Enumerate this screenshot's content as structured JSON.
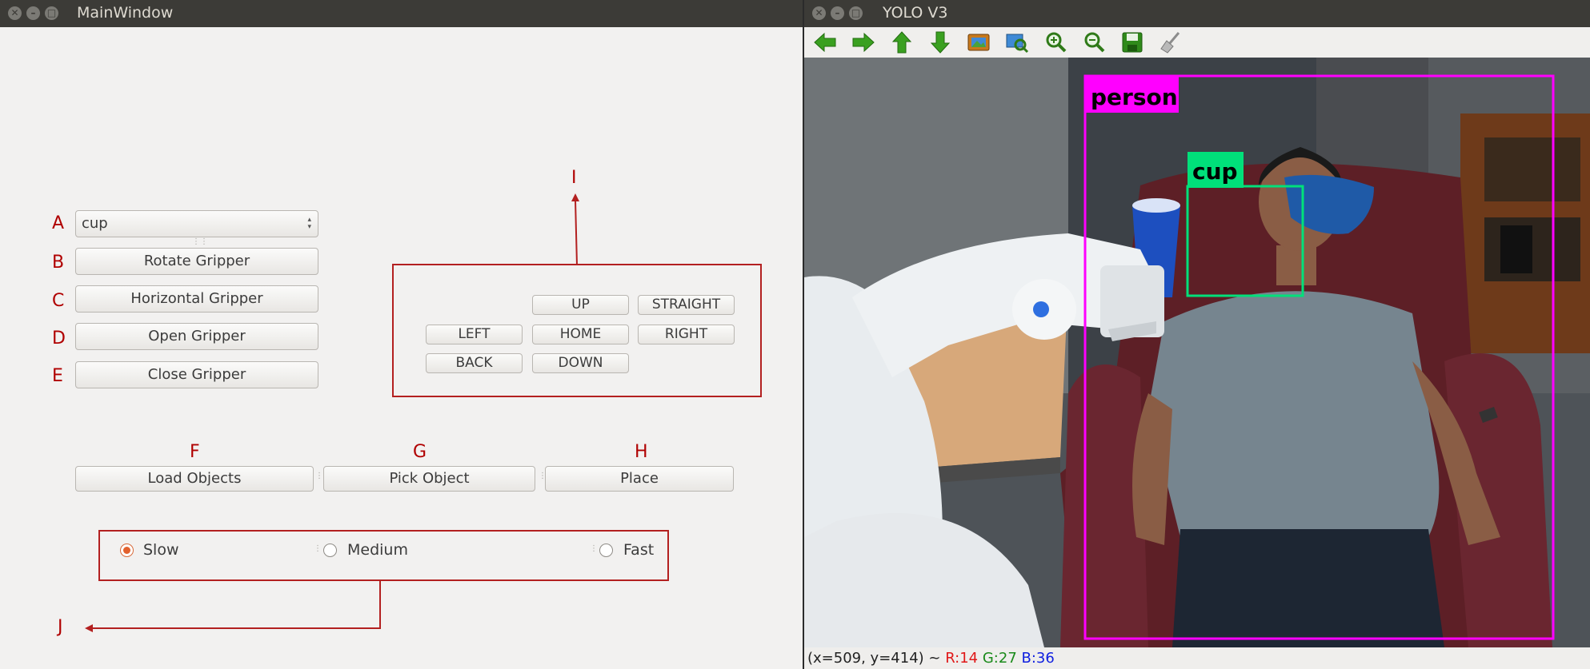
{
  "main_window": {
    "title": "MainWindow",
    "object_select": {
      "value": "cup"
    },
    "gripper_buttons": [
      {
        "letter": "A"
      },
      {
        "letter": "B",
        "label": "Rotate Gripper"
      },
      {
        "letter": "C",
        "label": "Horizontal Gripper"
      },
      {
        "letter": "D",
        "label": "Open Gripper"
      },
      {
        "letter": "E",
        "label": "Close Gripper"
      }
    ],
    "jog": {
      "annotation": "I",
      "up": "UP",
      "straight": "STRAIGHT",
      "left": "LEFT",
      "home": "HOME",
      "right": "RIGHT",
      "back": "BACK",
      "down": "DOWN"
    },
    "actions": [
      {
        "letter": "F",
        "label": "Load Objects"
      },
      {
        "letter": "G",
        "label": "Pick Object"
      },
      {
        "letter": "H",
        "label": "Place"
      }
    ],
    "speed": {
      "annotation": "J",
      "options": [
        "Slow",
        "Medium",
        "Fast"
      ],
      "selected": "Slow"
    },
    "annotation_color": "#b00000"
  },
  "yolo_window": {
    "title": "YOLO V3",
    "toolbar": [
      "back-arrow-icon",
      "forward-arrow-icon",
      "up-arrow-icon",
      "down-arrow-icon",
      "image-icon",
      "zoom-fit-icon",
      "zoom-in-icon",
      "zoom-out-icon",
      "save-icon",
      "clear-icon"
    ],
    "detections": [
      {
        "label": "person",
        "color": "#ff00ff"
      },
      {
        "label": "cup",
        "color": "#00e07a"
      }
    ],
    "status": {
      "coords": "(x=509, y=414) ~ ",
      "r": "R:14",
      "g": "G:27",
      "b": "B:36"
    }
  }
}
